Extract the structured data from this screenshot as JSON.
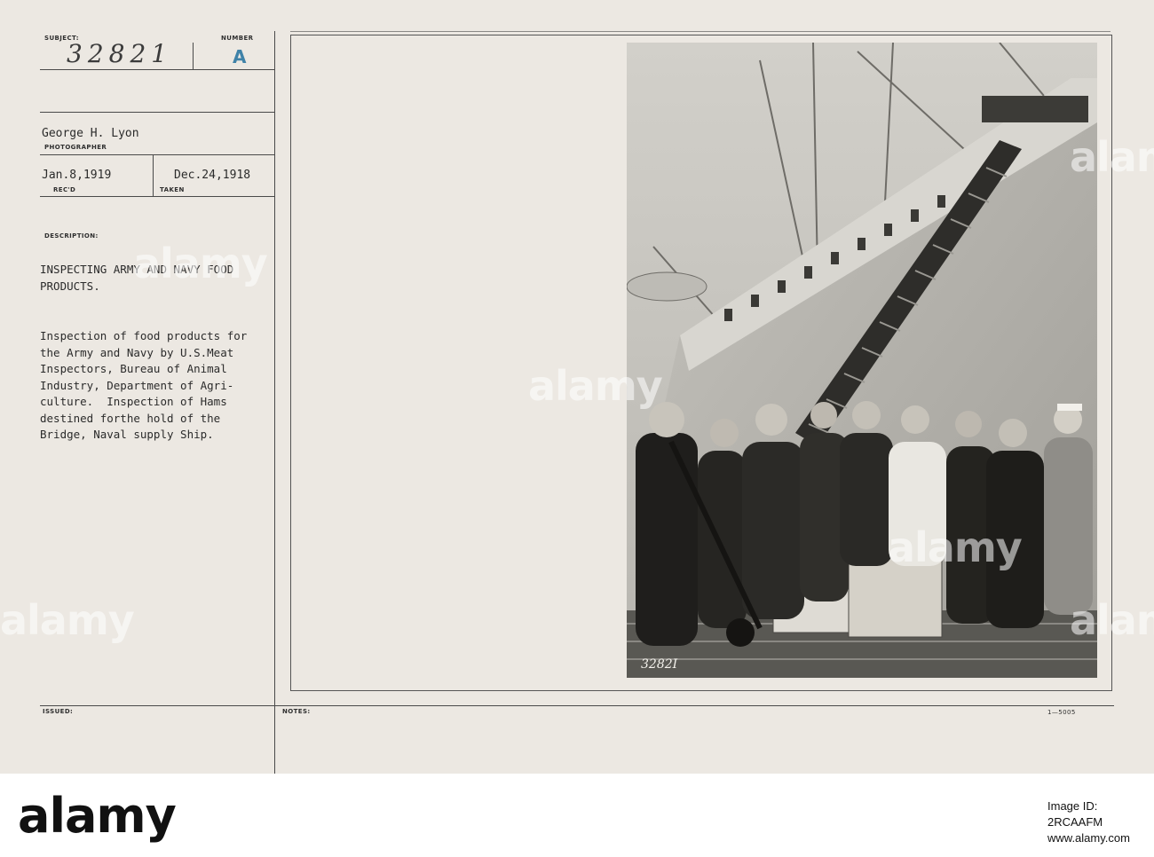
{
  "card": {
    "subject_label": "SUBJECT:",
    "subject_value": "32821",
    "number_label": "NUMBER",
    "number_value": "A",
    "photographer_name": "George H. Lyon",
    "photographer_label": "PHOTOGRAPHER",
    "received_date": "Jan.8,1919",
    "received_label": "REC'D",
    "taken_date": "Dec.24,1918",
    "taken_label": "TAKEN",
    "description_label": "DESCRIPTION:",
    "title": "INSPECTING ARMY AND NAVY FOOD\nPRODUCTS.",
    "body": "Inspection of food products for\nthe Army and Navy by U.S.Meat\nInspectors, Bureau of Animal\nIndustry, Department of Agri-\nculture.  Inspection of Hams\ndestined forthe hold of the\nBridge, Naval supply Ship.",
    "issued_label": "ISSUED:",
    "notes_label": "NOTES:",
    "form_number": "1—5005",
    "photo_negative_number": "3282I"
  },
  "watermark": {
    "text": "alamy"
  },
  "stock_strip": {
    "logo": "alamy",
    "image_id_line1": "Image ID: 2RCAAFM",
    "image_id_line2": "www.alamy.com"
  },
  "colors": {
    "card": "#ece8e2",
    "photo_sky": "#c9c7c1",
    "ship_hull": "#b9b7b1",
    "ink": "#2b2b2b"
  }
}
